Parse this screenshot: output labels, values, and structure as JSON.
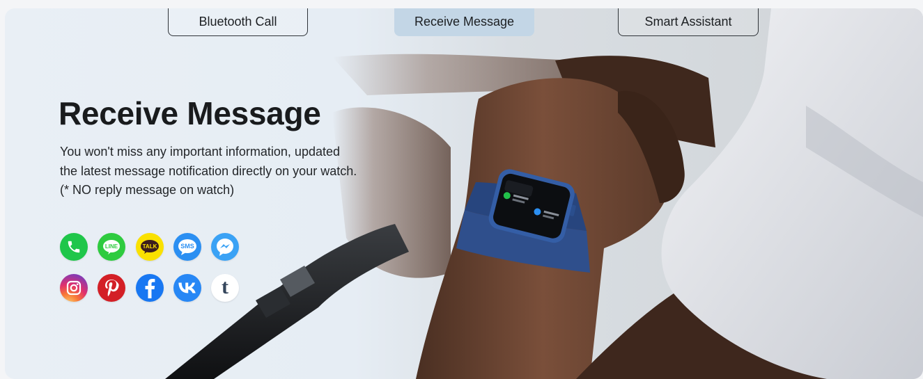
{
  "tabs": [
    {
      "label": "Bluetooth Call",
      "active": false
    },
    {
      "label": "Receive Message",
      "active": true
    },
    {
      "label": "Smart Assistant",
      "active": false
    }
  ],
  "feature": {
    "title": "Receive Message",
    "description_lines": [
      "You won't miss any important information, updated",
      "the latest message notification directly on your watch.",
      "(* NO reply message on watch)"
    ]
  },
  "app_icons": {
    "row1": [
      {
        "name": "phone-icon",
        "color": "#1fc64a"
      },
      {
        "name": "line-icon",
        "label": "LINE",
        "color": "#2ecb3f"
      },
      {
        "name": "kakaotalk-icon",
        "label": "TALK",
        "color": "#fae100"
      },
      {
        "name": "sms-icon",
        "label": "SMS",
        "color": "#2b8ff2"
      },
      {
        "name": "messenger-icon",
        "color": "#3aa2f5"
      }
    ],
    "row2": [
      {
        "name": "instagram-icon",
        "color": "#d62f7d"
      },
      {
        "name": "pinterest-icon",
        "color": "#d31f26"
      },
      {
        "name": "facebook-icon",
        "color": "#1877f2"
      },
      {
        "name": "vk-icon",
        "color": "#2787f5"
      },
      {
        "name": "tumblr-icon",
        "label": "t",
        "color": "#ffffff"
      }
    ]
  },
  "colors": {
    "active_tab": "#c3d6e6",
    "headline": "#191b1d",
    "watch_band": "#2f4f8c"
  }
}
